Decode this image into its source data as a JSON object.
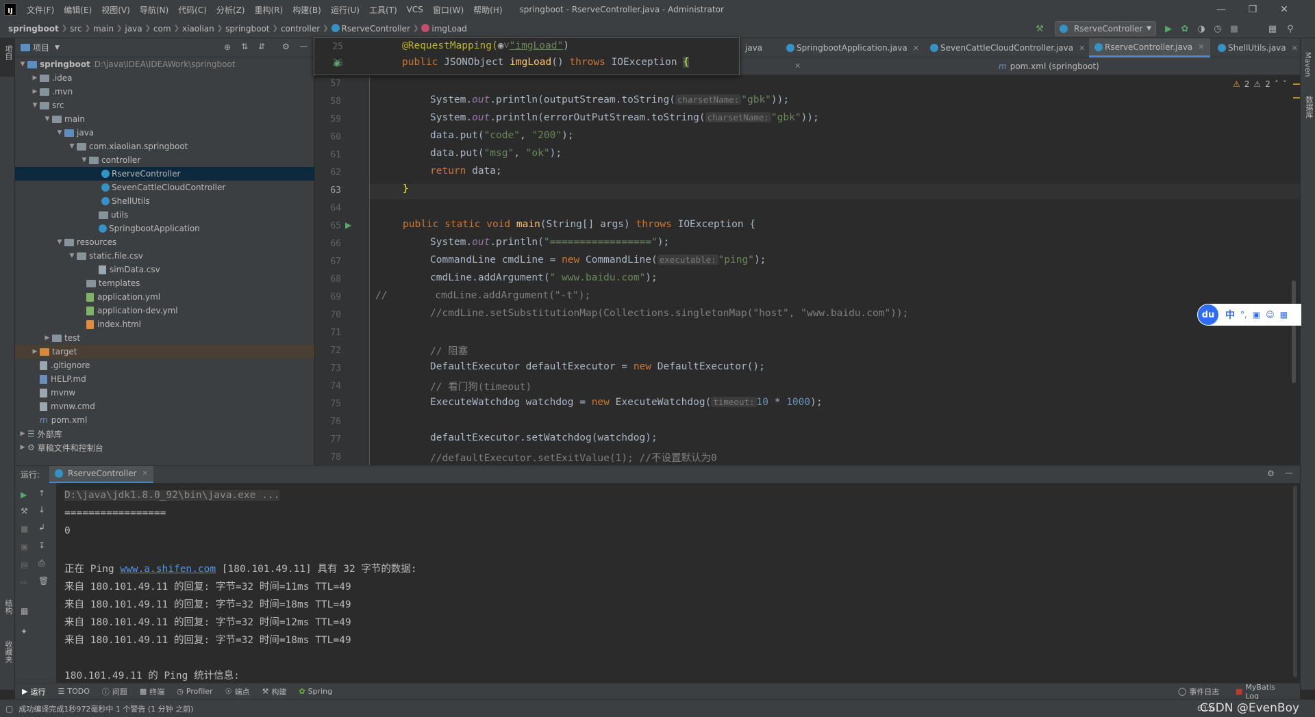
{
  "menu": [
    "文件(F)",
    "编辑(E)",
    "视图(V)",
    "导航(N)",
    "代码(C)",
    "分析(Z)",
    "重构(R)",
    "构建(B)",
    "运行(U)",
    "工具(T)",
    "VCS",
    "窗口(W)",
    "帮助(H)"
  ],
  "window_title": "springboot - RserveController.java - Administrator",
  "breadcrumb": [
    "springboot",
    "src",
    "main",
    "java",
    "com",
    "xiaolian",
    "springboot",
    "controller",
    "RserveController",
    "imgLoad"
  ],
  "run_config": "RserveController",
  "project": {
    "header": "项目",
    "tree": [
      {
        "label": "springboot",
        "extra": "D:\\java\\IDEA\\IDEAWork\\springboot"
      },
      {
        "label": ".idea"
      },
      {
        "label": ".mvn"
      },
      {
        "label": "src"
      },
      {
        "label": "main"
      },
      {
        "label": "java"
      },
      {
        "label": "com.xiaolian.springboot"
      },
      {
        "label": "controller"
      },
      {
        "label": "RserveController"
      },
      {
        "label": "SevenCattleCloudController"
      },
      {
        "label": "ShellUtils"
      },
      {
        "label": "utils"
      },
      {
        "label": "SpringbootApplication"
      },
      {
        "label": "resources"
      },
      {
        "label": "static.file.csv"
      },
      {
        "label": "simData.csv"
      },
      {
        "label": "templates"
      },
      {
        "label": "application.yml"
      },
      {
        "label": "application-dev.yml"
      },
      {
        "label": "index.html"
      },
      {
        "label": "test"
      },
      {
        "label": "target"
      },
      {
        "label": ".gitignore"
      },
      {
        "label": "HELP.md"
      },
      {
        "label": "mvnw"
      },
      {
        "label": "mvnw.cmd"
      },
      {
        "label": "pom.xml"
      },
      {
        "label": "外部库"
      },
      {
        "label": "草稿文件和控制台"
      }
    ]
  },
  "tabs": [
    "java",
    "SpringbootApplication.java",
    "SevenCattleCloudController.java",
    "RserveController.java",
    "ShellUtils.java"
  ],
  "tab2": "pom.xml (springboot)",
  "inspections": {
    "warnings": "2",
    "weak": "2"
  },
  "sticky": {
    "ln1": "25",
    "ln2": "26",
    "annotation": "@RequestMapping(",
    "ann_value": "\"imgLoad\"",
    "ann_close": ")",
    "method_kw": "public ",
    "method_type": "JSONObject ",
    "method_name": "imgLoad",
    "method_rest": "() ",
    "throws": "throws ",
    "exc": "IOException ",
    "brace": "{"
  },
  "code_lines": {
    "l57": "57",
    "l58": "58",
    "l59": "59",
    "l60": "60",
    "l61": "61",
    "l62": "62",
    "l63": "63",
    "l64": "64",
    "l65": "65",
    "l66": "66",
    "l67": "67",
    "l68": "68",
    "l69": "69",
    "l70": "70",
    "l71": "71",
    "l72": "72",
    "l73": "73",
    "l74": "74",
    "l75": "75",
    "l76": "76",
    "l77": "77",
    "l78": "78"
  },
  "code": {
    "c58_a": "System.",
    "c58_out": "out",
    "c58_b": ".println(outputStream.toString(",
    "c58_hint": "charsetName:",
    "c58_str": "\"gbk\"",
    "c58_c": "));",
    "c59_a": "System.",
    "c59_out": "out",
    "c59_b": ".println(errorOutPutStream.toString(",
    "c59_hint": "charsetName:",
    "c59_str": "\"gbk\"",
    "c59_c": "));",
    "c60_a": "data.put(",
    "c60_s1": "\"code\"",
    "c60_b": ", ",
    "c60_s2": "\"200\"",
    "c60_c": ");",
    "c61_a": "data.put(",
    "c61_s1": "\"msg\"",
    "c61_b": ", ",
    "c61_s2": "\"ok\"",
    "c61_c": ");",
    "c62_kw": "return ",
    "c62_b": "data;",
    "c63": "}",
    "c65_kw": "public static void ",
    "c65_fn": "main",
    "c65_b": "(String[] args) ",
    "c65_kw2": "throws ",
    "c65_c": "IOException {",
    "c66_a": "System.",
    "c66_out": "out",
    "c66_b": ".println(",
    "c66_s": "\"=================\"",
    "c66_c": ");",
    "c67_a": "CommandLine cmdLine = ",
    "c67_kw": "new ",
    "c67_b": "CommandLine(",
    "c67_hint": "executable:",
    "c67_s": "\"ping\"",
    "c67_c": ");",
    "c68_a": "cmdLine.addArgument(",
    "c68_s": "\" www.baidu.com\"",
    "c68_c": ");",
    "c69": "//        cmdLine.addArgument(\"-t\");",
    "c70": "//cmdLine.setSubstitutionMap(Collections.singletonMap(\"host\", \"www.baidu.com\"));",
    "c72": "// 阻塞",
    "c73_a": "DefaultExecutor defaultExecutor = ",
    "c73_kw": "new ",
    "c73_b": "DefaultExecutor();",
    "c74": "// 看门狗(timeout)",
    "c75_a": "ExecuteWatchdog watchdog = ",
    "c75_kw": "new ",
    "c75_b": "ExecuteWatchdog(",
    "c75_hint": "timeout:",
    "c75_n1": "10",
    "c75_op": " * ",
    "c75_n2": "1000",
    "c75_c": ");",
    "c77": "defaultExecutor.setWatchdog(watchdog);",
    "c78": "//defaultExecutor.setExitValue(1); //不设置默认为0"
  },
  "run": {
    "label": "运行:",
    "tab": "RserveController",
    "lines": {
      "l1": "D:\\java\\jdk1.8.0_92\\bin\\java.exe ...",
      "l2": "=================",
      "l3": "0",
      "l5_a": "正在 Ping ",
      "l5_link": "www.a.shifen.com",
      "l5_b": " [180.101.49.11] 具有 32 字节的数据:",
      "l6": "来自 180.101.49.11 的回复: 字节=32 时间=11ms TTL=49",
      "l7": "来自 180.101.49.11 的回复: 字节=32 时间=18ms TTL=49",
      "l8": "来自 180.101.49.11 的回复: 字节=32 时间=12ms TTL=49",
      "l9": "来自 180.101.49.11 的回复: 字节=32 时间=18ms TTL=49",
      "l11": "180.101.49.11 的 Ping 统计信息:"
    }
  },
  "bottom_tools": [
    "运行",
    "TODO",
    "问题",
    "终端",
    "Profiler",
    "端点",
    "构建",
    "Spring"
  ],
  "bottom_right": {
    "event_log": "事件日志",
    "mybatis": "MyBatis Log"
  },
  "status": {
    "message": "成功编译完成1秒972毫秒中 1 个警告 (1 分钟 之前)",
    "position": "63:6"
  },
  "watermark": "CSDN @EvenBoy",
  "left_strip": {
    "project": "项目",
    "structure": "结构",
    "favorites": "收藏夹"
  },
  "right_strip": {
    "maven": "Maven",
    "database": "数据库"
  },
  "ime": {
    "logo": "du",
    "mode": "中"
  }
}
